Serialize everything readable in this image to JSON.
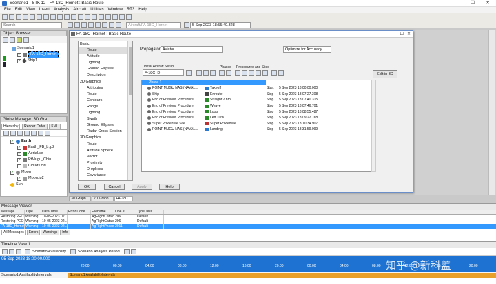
{
  "window": {
    "title": "Scenario1 - STK 12 - FA-18C_Hornet : Basic Route"
  },
  "menu": [
    "File",
    "Edit",
    "View",
    "Insert",
    "Analysis",
    "Aircraft",
    "Utilities",
    "Window",
    "RT3",
    "Help"
  ],
  "toolbar": {
    "object_combo": "Aircraft/FA-18C_Hornet",
    "time": "5 Sep 2023 18:55:40.328",
    "search_placeholder": "Search"
  },
  "object_browser": {
    "title": "Object Browser",
    "items": [
      "Scenario1",
      "FA-18C_Hornet",
      "Ship1"
    ]
  },
  "globe_manager": {
    "title": "Globe Manager: 3D Gra...",
    "tabs": [
      "Hierarchy",
      "Render Order",
      "KML"
    ],
    "items": [
      "Earth",
      "Earth_FB_b.jp2",
      "Aerial.ve",
      "PtMugu_Chin",
      "Clouds.cld",
      "Moon",
      "Moon.jp2",
      "Sun"
    ]
  },
  "dialog": {
    "title": "FA-18C_Hornet : Basic Route",
    "nav": [
      {
        "label": "Basic",
        "level": 0
      },
      {
        "label": "Route",
        "level": 1
      },
      {
        "label": "Attitude",
        "level": 1
      },
      {
        "label": "Lighting",
        "level": 1
      },
      {
        "label": "Ground Ellipses",
        "level": 1
      },
      {
        "label": "Description",
        "level": 1
      },
      {
        "label": "2D Graphics",
        "level": 0
      },
      {
        "label": "Attributes",
        "level": 1
      },
      {
        "label": "Route",
        "level": 1
      },
      {
        "label": "Contours",
        "level": 1
      },
      {
        "label": "Range",
        "level": 1
      },
      {
        "label": "Lighting",
        "level": 1
      },
      {
        "label": "Swath",
        "level": 1
      },
      {
        "label": "Ground Ellipses",
        "level": 1
      },
      {
        "label": "Radar Cross Section",
        "level": 1
      },
      {
        "label": "3D Graphics",
        "level": 0
      },
      {
        "label": "Route",
        "level": 1
      },
      {
        "label": "Attitude Sphere",
        "level": 1
      },
      {
        "label": "Vector",
        "level": 1
      },
      {
        "label": "Proximity",
        "level": 1
      },
      {
        "label": "Droplines",
        "level": 1
      },
      {
        "label": "Covariance",
        "level": 1
      }
    ],
    "propagator_label": "Propagator:",
    "propagator_value": "Aviator",
    "optimize_value": "Optimize for Accuracy",
    "initial_setup_label": "Initial Aircraft Setup",
    "aircraft_value": "F-18C_D",
    "phases_label": "Phases",
    "procedures_label": "Procedures and Sites",
    "edit_3d": "Edit in 3D",
    "phase_header": "Phase 1",
    "sequence": [
      {
        "site": "POINT MUGU NAS (NAVAL...",
        "proc": "Takeoff",
        "kind": "Start",
        "time": "5 Sep 2023 18:00:00.000"
      },
      {
        "site": "Ship",
        "proc": "Enroute",
        "kind": "Stop",
        "time": "5 Sep 2023 18:07:27.308"
      },
      {
        "site": "End of Previous Procedure",
        "proc": "Straight 2 nm",
        "kind": "Stop",
        "time": "5 Sep 2023 18:07:40.315"
      },
      {
        "site": "End of Previous Procedure",
        "proc": "Weave",
        "kind": "Stop",
        "time": "5 Sep 2023 18:07:46.701"
      },
      {
        "site": "End of Previous Procedure",
        "proc": "Loop",
        "kind": "Stop",
        "time": "5 Sep 2023 18:08:55.487"
      },
      {
        "site": "End of Previous Procedure",
        "proc": "Left Turn",
        "kind": "Stop",
        "time": "5 Sep 2023 18:09:22.768"
      },
      {
        "site": "Super Procedure Site",
        "proc": "Super Procedure",
        "kind": "Stop",
        "time": "5 Sep 2023 18:10:34.907"
      },
      {
        "site": "POINT MUGU NAS (NAVAL...",
        "proc": "Landing",
        "kind": "Stop",
        "time": "5 Sep 2023 18:31:59.099"
      }
    ],
    "buttons": {
      "ok": "OK",
      "cancel": "Cancel",
      "apply": "Apply",
      "help": "Help"
    }
  },
  "doc_tabs": [
    "3D Graph...",
    "2D Graph...",
    "FA-18C..."
  ],
  "message_viewer": {
    "title": "Message Viewer",
    "columns": [
      "Message",
      "Type",
      "Date/Time",
      "Error Code",
      "Filename",
      "Line #",
      "TypeDesc"
    ],
    "rows": [
      [
        "Restoring PEO",
        "Warning",
        "10-05-2023 02:...",
        "",
        "AgFlightCatalo",
        "206",
        "Default"
      ],
      [
        "Restoring PEO",
        "Warning",
        "10-05-2023 02:...",
        "",
        "AgFlightCatalo",
        "206",
        "Default"
      ],
      [
        "FA-18C_Hornet",
        "Warning",
        "10-05-2023 02:...",
        "",
        "AgFlightPhase...",
        "2011",
        "Default"
      ]
    ],
    "filters": [
      "All Messages",
      "Errors",
      "Warnings",
      "Info"
    ]
  },
  "timeline": {
    "title": "Timeline View 1",
    "start": "05 Sep 2023 18:00:00.000",
    "scenario_availability": "Scenario Availability",
    "scenario_period": "Scenario Analysis Period",
    "ticks": [
      "20:00",
      "00:00",
      "04:00",
      "08:00",
      "12:00",
      "16:00",
      "20:00",
      "00:00",
      "04:00",
      "08:00",
      "12:00",
      "16:00",
      "20:00",
      "00:00"
    ],
    "row_label": "Scenario1 AvailabilityIntervals",
    "bar_label": "Scenario1 AvailabilityIntervals"
  },
  "watermark": "知乎 @新科盖",
  "colors": {
    "selection": "#3399ff",
    "timeline_blue": "#1e73d2",
    "timeline_orange": "#e8a02a"
  }
}
